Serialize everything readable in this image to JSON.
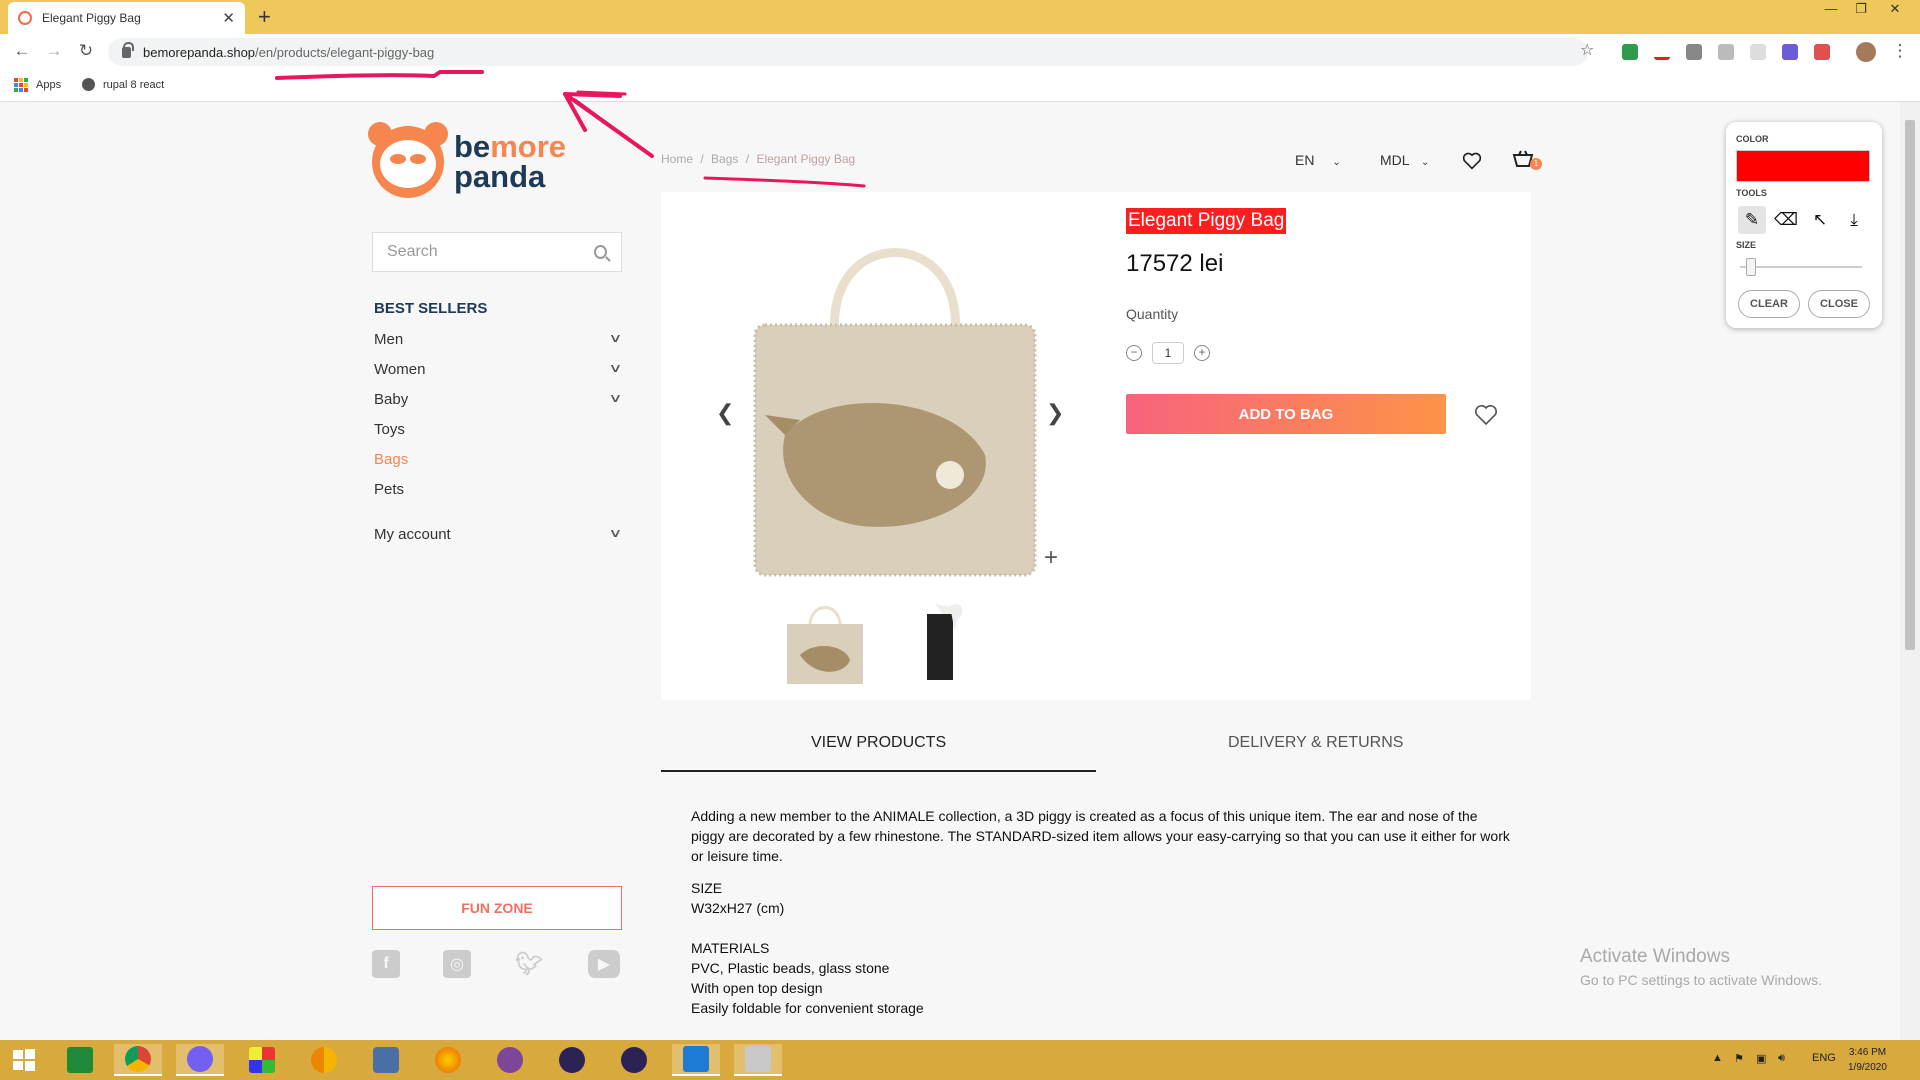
{
  "browser": {
    "tab_title": "Elegant Piggy Bag",
    "url_host": "bemorepanda.shop",
    "url_path": "/en/products/elegant-piggy-bag",
    "bookmarks": [
      "Apps",
      "rupal 8 react"
    ]
  },
  "site": {
    "logo_line1_a": "be",
    "logo_line1_b": "more",
    "logo_line2": "panda",
    "breadcrumb": [
      "Home",
      "Bags",
      "Elegant Piggy Bag"
    ],
    "breadcrumb_sep": "/",
    "language": "EN",
    "currency": "MDL",
    "cart_count": "1"
  },
  "sidebar": {
    "search_placeholder": "Search",
    "section_title": "BEST SELLERS",
    "categories": [
      {
        "label": "Men",
        "expandable": true
      },
      {
        "label": "Women",
        "expandable": true
      },
      {
        "label": "Baby",
        "expandable": true
      },
      {
        "label": "Toys",
        "expandable": false
      },
      {
        "label": "Bags",
        "expandable": false,
        "active": true
      },
      {
        "label": "Pets",
        "expandable": false
      }
    ],
    "account": "My account",
    "fun_zone": "FUN ZONE",
    "social_icons": [
      "facebook-icon",
      "instagram-icon",
      "twitter-icon",
      "youtube-icon"
    ]
  },
  "product": {
    "title": "Elegant Piggy Bag",
    "price": "17572 lei",
    "quantity_label": "Quantity",
    "quantity": "1",
    "add_to_bag": "ADD TO BAG"
  },
  "tabs": [
    "VIEW PRODUCTS",
    "DELIVERY & RETURNS"
  ],
  "description": {
    "paragraph": "Adding a new member to the ANIMALE collection, a 3D piggy is created as a focus of this unique item. The ear and nose of the piggy are decorated by a few rhinestone. The STANDARD-sized item allows your easy-carrying so that you can use it either for work or leisure time.",
    "size_title": "SIZE",
    "size_value": "W32xH27 (cm)",
    "materials_title": "MATERIALS",
    "materials": [
      "PVC, Plastic beads, glass stone",
      "With open top design",
      "Easily foldable for convenient storage"
    ]
  },
  "draw_panel": {
    "color_label": "COLOR",
    "tools_label": "TOOLS",
    "size_label": "SIZE",
    "clear": "CLEAR",
    "close": "CLOSE",
    "selected_color": "#ff0000",
    "brush_size_fraction": 0.15
  },
  "watermark": {
    "line1": "Activate Windows",
    "line2": "Go to PC settings to activate Windows."
  },
  "taskbar": {
    "lang": "ENG",
    "time": "3:46 PM",
    "date": "1/9/2020"
  },
  "colors": {
    "accent": "#f6854e",
    "navy": "#1d3a57",
    "highlight_red": "#ff1e1e",
    "titlebar": "#f0c75a",
    "taskbar": "#d8a93c"
  }
}
